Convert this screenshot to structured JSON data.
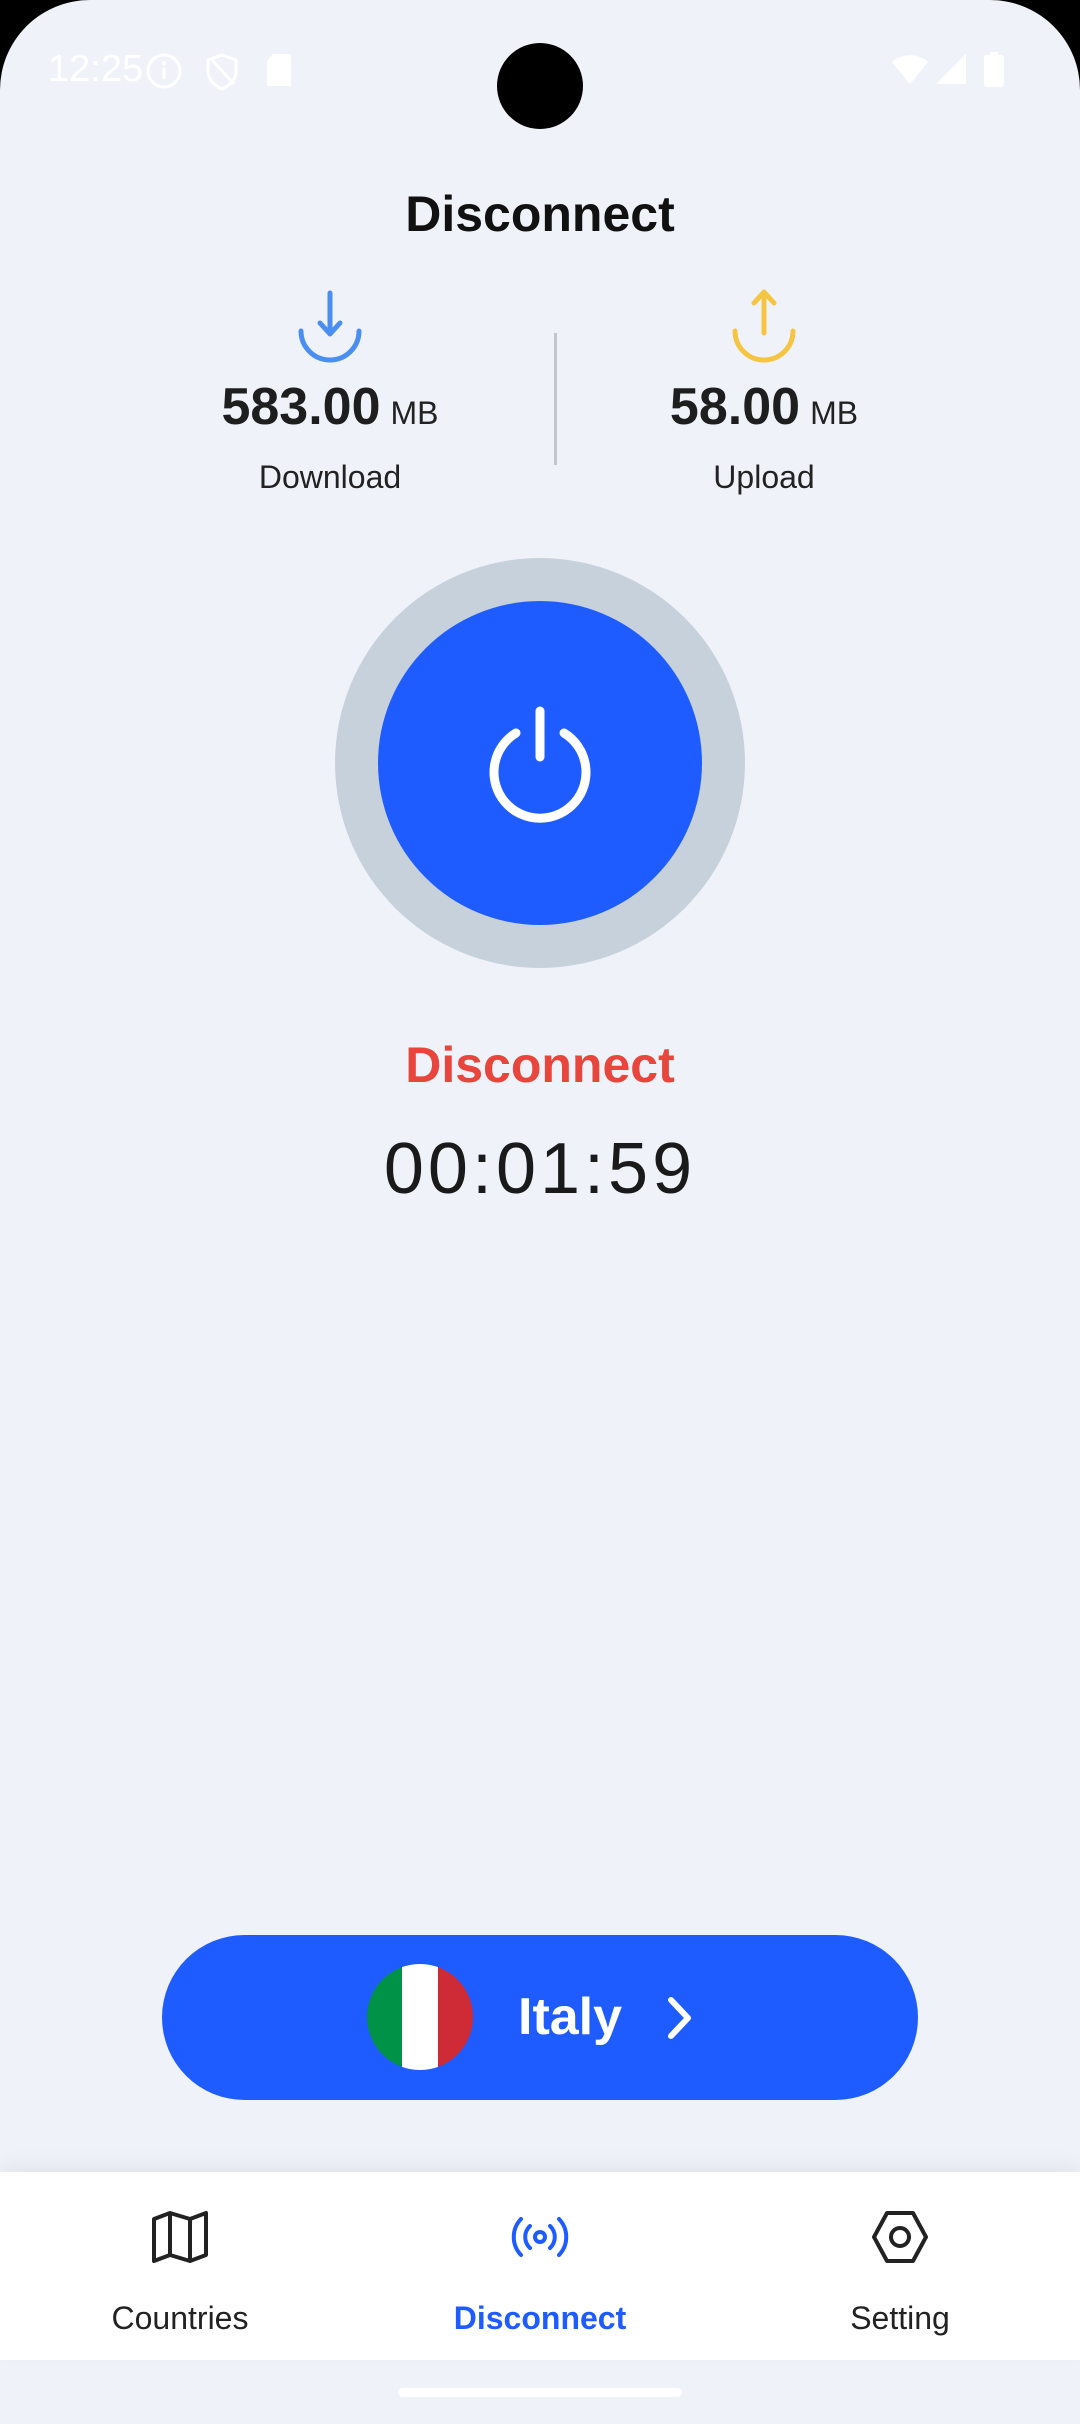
{
  "status_bar": {
    "time": "12:25",
    "icons": [
      "info-icon",
      "shield-icon",
      "sd-card-icon",
      "wifi-icon",
      "signal-icon",
      "battery-icon"
    ]
  },
  "header": {
    "title": "Disconnect"
  },
  "stats": {
    "download": {
      "value": "583.00",
      "unit": "MB",
      "label": "Download",
      "icon": "download-icon",
      "color": "#4a8ef2"
    },
    "upload": {
      "value": "58.00",
      "unit": "MB",
      "label": "Upload",
      "icon": "upload-icon",
      "color": "#f5c542"
    }
  },
  "power": {
    "icon": "power-icon",
    "color": "#1f5cff",
    "ring_color": "#c7d1dc"
  },
  "connection": {
    "status": "Disconnect",
    "status_color": "#e8453c",
    "timer": "00:01:59"
  },
  "country": {
    "name": "Italy",
    "flag_icon": "italy-flag-icon",
    "flag_colors": [
      "#009246",
      "#ffffff",
      "#ce2b37"
    ]
  },
  "nav": {
    "items": [
      {
        "label": "Countries",
        "icon": "map-icon",
        "active": false
      },
      {
        "label": "Disconnect",
        "icon": "broadcast-icon",
        "active": true
      },
      {
        "label": "Setting",
        "icon": "settings-icon",
        "active": false
      }
    ],
    "active_color": "#1f5cff"
  }
}
